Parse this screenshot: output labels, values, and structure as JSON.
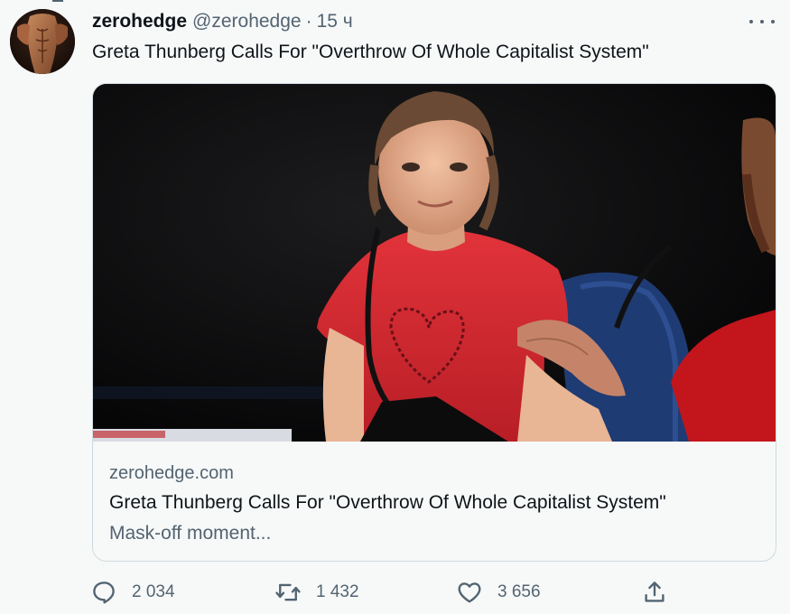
{
  "tweet": {
    "display_name": "zerohedge",
    "handle": "@zerohedge",
    "separator": "·",
    "time": "15 ч",
    "text": "Greta Thunberg Calls For \"Overthrow Of Whole Capitalist System\""
  },
  "card": {
    "domain": "zerohedge.com",
    "title": "Greta Thunberg Calls For \"Overthrow Of Whole Capitalist System\"",
    "description": "Mask-off moment..."
  },
  "actions": {
    "replies": "2 034",
    "retweets": "1 432",
    "likes": "3 656"
  },
  "icons": {
    "more": "more-horizontal-icon",
    "reply": "reply-icon",
    "retweet": "retweet-icon",
    "like": "heart-icon",
    "share": "share-icon"
  },
  "colors": {
    "background": "#f7f9f9",
    "primary_text": "#0f1419",
    "secondary_text": "#536471",
    "border": "#cfd9de"
  }
}
